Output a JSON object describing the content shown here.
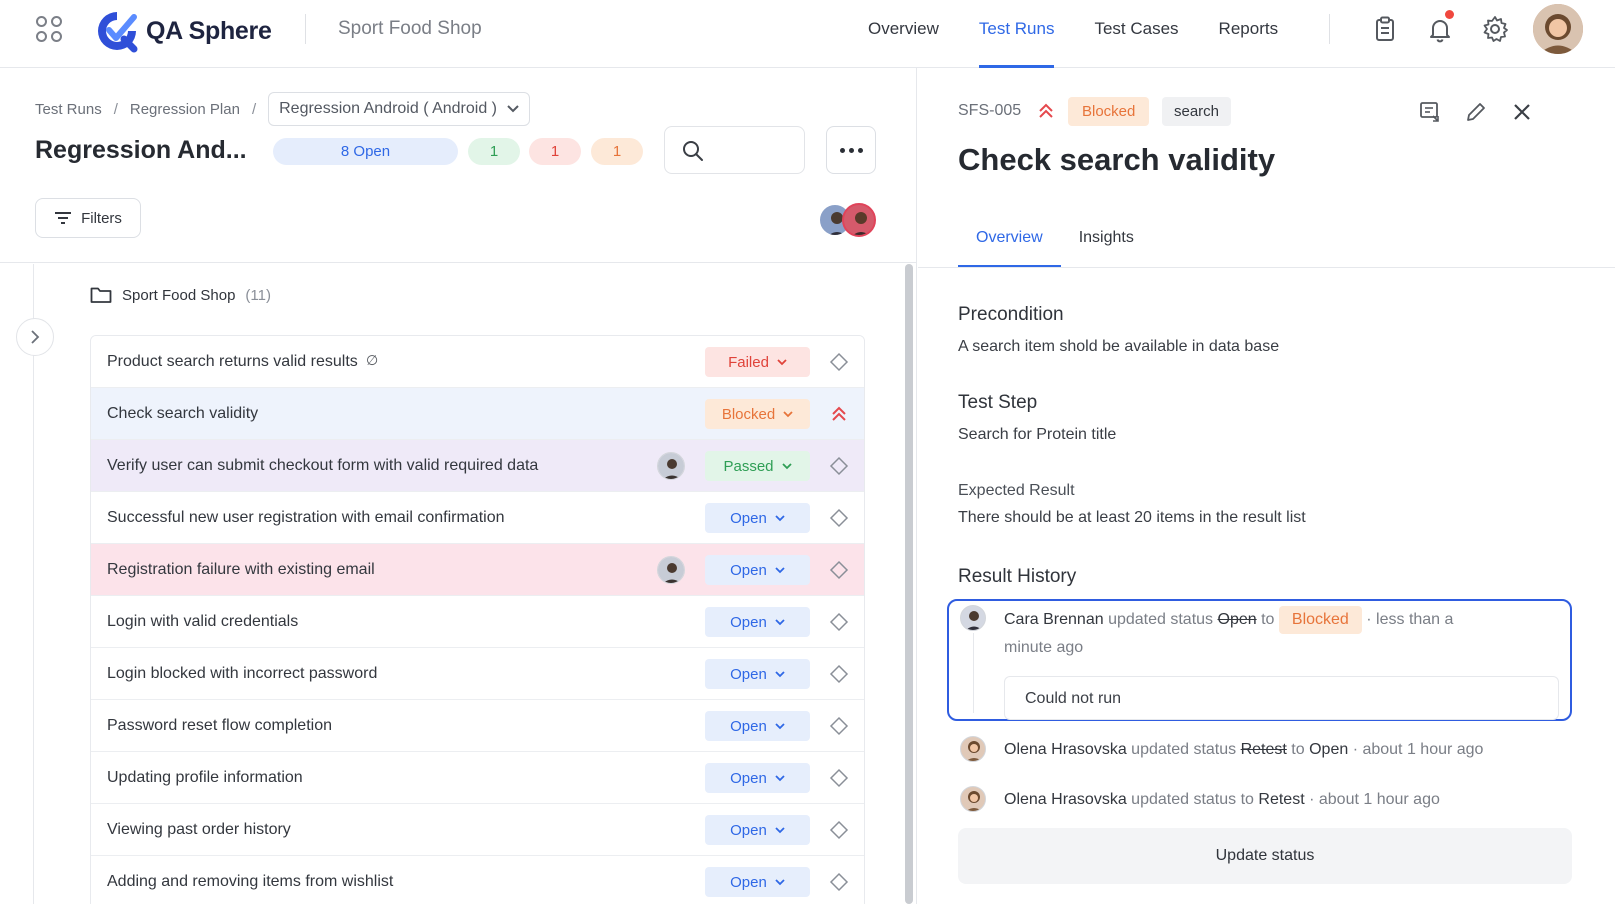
{
  "app": {
    "name": "QA Sphere",
    "project": "Sport Food Shop"
  },
  "nav": {
    "links": [
      {
        "label": "Overview",
        "active": false
      },
      {
        "label": "Test Runs",
        "active": true
      },
      {
        "label": "Test Cases",
        "active": false
      },
      {
        "label": "Reports",
        "active": false
      }
    ],
    "icons": [
      "clipboard-icon",
      "bell-icon",
      "gear-icon"
    ]
  },
  "breadcrumb": {
    "items": [
      "Test Runs",
      "Regression Plan"
    ],
    "separator": "/",
    "selected_run": "Regression Android ( Android )"
  },
  "run": {
    "title": "Regression And...",
    "counts": {
      "open": "8 Open",
      "passed": "1",
      "failed": "1",
      "blocked": "1"
    }
  },
  "toolbar": {
    "filters_label": "Filters"
  },
  "folder": {
    "name": "Sport Food Shop",
    "count": "(11)"
  },
  "cases": [
    {
      "title": "Product search returns valid results",
      "status": "Failed",
      "status_class": "failed",
      "priority": "medium",
      "highlight": "",
      "avatar": false,
      "has_no_steps_icon": true
    },
    {
      "title": "Check search validity",
      "status": "Blocked",
      "status_class": "blocked",
      "priority": "high",
      "highlight": "blue",
      "avatar": false
    },
    {
      "title": "Verify user can submit checkout form with valid required data",
      "status": "Passed",
      "status_class": "passed",
      "priority": "medium",
      "highlight": "lav",
      "avatar": true
    },
    {
      "title": "Successful new user registration with email confirmation",
      "status": "Open",
      "status_class": "open",
      "priority": "medium",
      "highlight": "",
      "avatar": false
    },
    {
      "title": "Registration failure with existing email",
      "status": "Open",
      "status_class": "open",
      "priority": "medium",
      "highlight": "pink",
      "avatar": true
    },
    {
      "title": "Login with valid credentials",
      "status": "Open",
      "status_class": "open",
      "priority": "medium",
      "highlight": "",
      "avatar": false
    },
    {
      "title": "Login blocked with incorrect password",
      "status": "Open",
      "status_class": "open",
      "priority": "medium",
      "highlight": "",
      "avatar": false
    },
    {
      "title": "Password reset flow completion",
      "status": "Open",
      "status_class": "open",
      "priority": "medium",
      "highlight": "",
      "avatar": false
    },
    {
      "title": "Updating profile information",
      "status": "Open",
      "status_class": "open",
      "priority": "medium",
      "highlight": "",
      "avatar": false
    },
    {
      "title": "Viewing past order history",
      "status": "Open",
      "status_class": "open",
      "priority": "medium",
      "highlight": "",
      "avatar": false
    },
    {
      "title": "Adding and removing items from wishlist",
      "status": "Open",
      "status_class": "open",
      "priority": "medium",
      "highlight": "",
      "avatar": false
    }
  ],
  "detail": {
    "key": "SFS-005",
    "status": "Blocked",
    "tag": "search",
    "title": "Check search validity",
    "tabs": [
      "Overview",
      "Insights"
    ],
    "precondition_heading": "Precondition",
    "precondition": "A search item shold be available in data base",
    "step_heading": "Test Step",
    "step": "Search for Protein title",
    "expected_heading": "Expected Result",
    "expected": "There should be at least 20 items in the result list",
    "history_heading": "Result History",
    "history": [
      {
        "user": "Cara Brennan",
        "verb": "updated status",
        "from": "Open",
        "to_word": "to",
        "to": "Blocked",
        "time": "· less than a",
        "time_cont": "minute ago",
        "comment": "Could not run"
      },
      {
        "user": "Olena Hrasovska",
        "verb": "updated status",
        "from": "Retest",
        "to_word": "to",
        "to": "Open",
        "time": "· about 1 hour ago"
      },
      {
        "user": "Olena Hrasovska",
        "verb": "updated status to",
        "to": "Retest",
        "time": "· about 1 hour ago"
      }
    ],
    "update_button": "Update status"
  },
  "colors": {
    "accent": "#2f68e6",
    "failed": "#e0433a",
    "blocked": "#e7743a",
    "passed": "#2f9e55",
    "highlight_border": "#2f5ce0"
  }
}
